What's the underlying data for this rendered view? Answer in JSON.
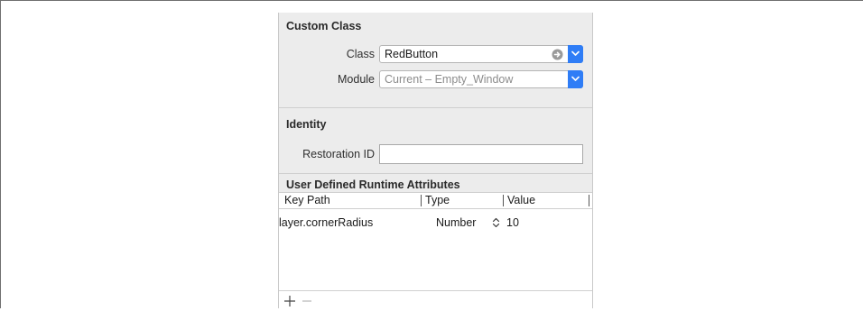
{
  "custom_class": {
    "title": "Custom Class",
    "class_label": "Class",
    "class_value": "RedButton",
    "module_label": "Module",
    "module_value": "Current – Empty_Window"
  },
  "identity": {
    "title": "Identity",
    "restoration_label": "Restoration ID",
    "restoration_value": ""
  },
  "runtime_attributes": {
    "title": "User Defined Runtime Attributes",
    "columns": [
      "Key Path",
      "Type",
      "Value"
    ],
    "rows": [
      {
        "key_path": "layer.cornerRadius",
        "type": "Number",
        "value": "10"
      }
    ]
  },
  "icons": {
    "goto": "arrow-circle-icon",
    "dropdown": "chevron-down-icon",
    "stepper": "up-down-stepper-icon",
    "add": "plus-icon",
    "remove": "minus-icon"
  },
  "colors": {
    "accent": "#2f7df6",
    "panel_bg": "#ececec"
  }
}
